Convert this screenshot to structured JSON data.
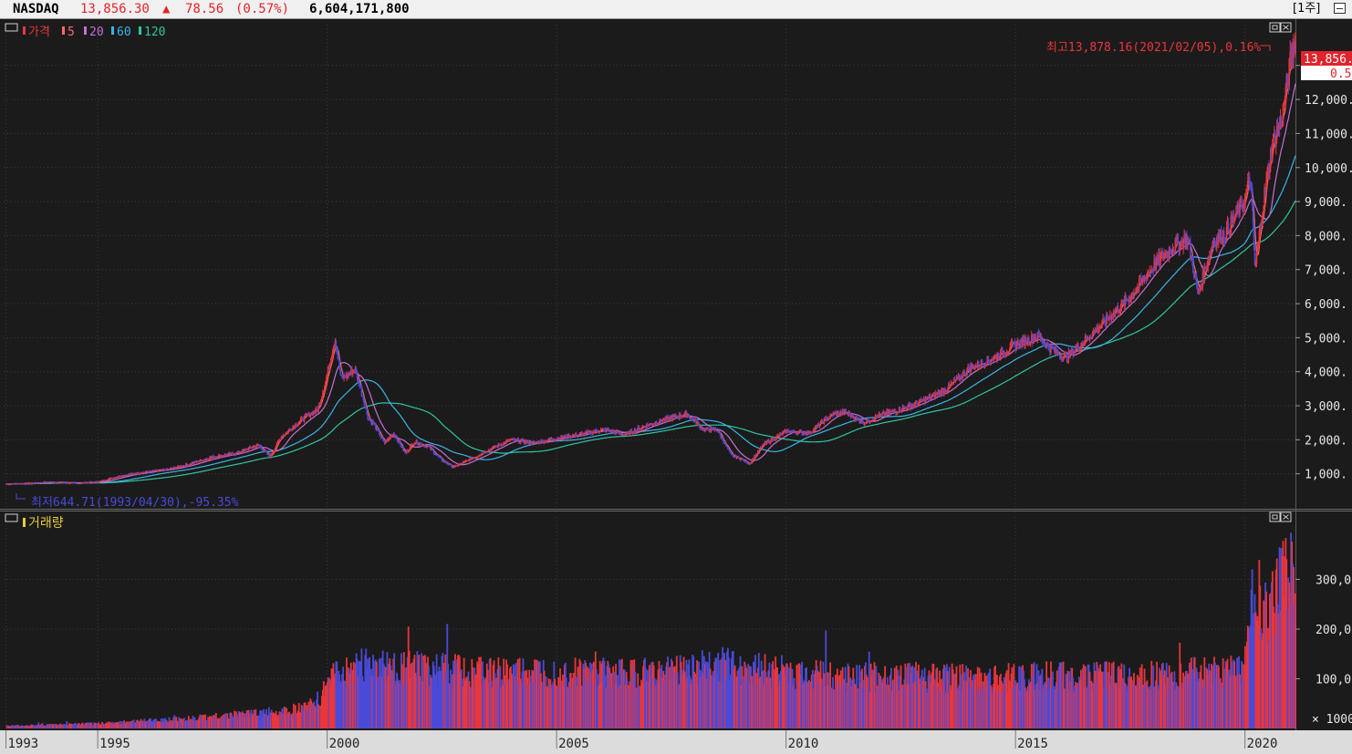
{
  "header": {
    "symbol": "NASDAQ",
    "price": "13,856.30",
    "arrow": "▲",
    "change": "78.56",
    "change_pct": "(0.57%)",
    "volume": "6,604,171,800",
    "period": "[1주]"
  },
  "colors": {
    "background": "#1b1b1b",
    "up": "#e8363b",
    "down": "#4a4ad8",
    "ma5": "#ff6a6a",
    "ma20": "#c66fd6",
    "ma60": "#3ab4e8",
    "ma120": "#2fc6a0",
    "grid": "#3c3c3c",
    "volume_label": "#e8c840",
    "high_label": "#e8363b",
    "low_label": "#4a4ad8"
  },
  "price_panel": {
    "legend": {
      "price": "가격",
      "ma5": "5",
      "ma20": "20",
      "ma60": "60",
      "ma120": "120"
    },
    "high_annotation": "최고13,878.16(2021/02/05),0.16%",
    "low_annotation": "최저644.71(1993/04/30),-95.35%",
    "last_value_tag": "13,856.",
    "last_change_tag": "0.5"
  },
  "volume_panel": {
    "legend": "거래량",
    "unit_label": "× 1000"
  },
  "chart_data": [
    {
      "type": "line",
      "title": "",
      "series_type": "weekly candlestick with moving averages",
      "x_label": "",
      "y_label": "",
      "x_ticks": [
        "1993",
        "1995",
        "2000",
        "2005",
        "2010",
        "2015",
        "2020"
      ],
      "y_ticks": [
        "1,000.",
        "2,000.",
        "3,000.",
        "4,000.",
        "5,000.",
        "6,000.",
        "7,000.",
        "8,000.",
        "9,000.",
        "10,000.",
        "11,000.",
        "12,000.",
        "13,000."
      ],
      "x_range": [
        1992.95,
        2021.1
      ],
      "ylim": [
        0,
        14200
      ],
      "grid": true,
      "last_value": 13856.3,
      "high": {
        "date": "2021/02/05",
        "value": 13878.16
      },
      "low": {
        "date": "1993/04/30",
        "value": 644.71
      },
      "price": {
        "x": [
          1993.0,
          1993.5,
          1994.0,
          1994.5,
          1995.0,
          1995.5,
          1996.0,
          1996.5,
          1997.0,
          1997.5,
          1998.0,
          1998.5,
          1998.75,
          1999.0,
          1999.5,
          1999.8,
          2000.0,
          2000.17,
          2000.3,
          2000.45,
          2000.6,
          2000.75,
          2000.9,
          2001.0,
          2001.25,
          2001.45,
          2001.7,
          2001.9,
          2002.2,
          2002.5,
          2002.75,
          2003.0,
          2003.5,
          2004.0,
          2004.5,
          2005.0,
          2005.5,
          2006.0,
          2006.5,
          2007.0,
          2007.5,
          2007.85,
          2008.2,
          2008.5,
          2008.8,
          2009.0,
          2009.2,
          2009.5,
          2010.0,
          2010.5,
          2011.0,
          2011.3,
          2011.7,
          2012.0,
          2012.5,
          2013.0,
          2013.5,
          2014.0,
          2014.5,
          2015.0,
          2015.5,
          2015.75,
          2016.1,
          2016.5,
          2017.0,
          2017.5,
          2018.0,
          2018.45,
          2018.75,
          2018.98,
          2019.3,
          2019.6,
          2020.0,
          2020.12,
          2020.22,
          2020.4,
          2020.6,
          2020.8,
          2021.0,
          2021.1
        ],
        "y": [
          700,
          720,
          760,
          720,
          760,
          950,
          1050,
          1120,
          1290,
          1500,
          1600,
          1850,
          1500,
          2100,
          2650,
          2900,
          3900,
          5000,
          3800,
          3900,
          4100,
          3400,
          2600,
          2500,
          1900,
          2200,
          1600,
          1950,
          1800,
          1400,
          1200,
          1350,
          1700,
          2000,
          1900,
          2050,
          2150,
          2300,
          2150,
          2450,
          2650,
          2750,
          2300,
          2300,
          1550,
          1450,
          1300,
          1850,
          2250,
          2200,
          2750,
          2800,
          2500,
          2700,
          2900,
          3150,
          3500,
          4100,
          4400,
          4800,
          5050,
          4700,
          4400,
          4900,
          5550,
          6200,
          7100,
          7700,
          7900,
          6300,
          7800,
          8100,
          9100,
          9700,
          7000,
          9000,
          10700,
          11400,
          13200,
          13856
        ]
      },
      "ma_notes": "MA5, MA20, MA60, MA120 smoothed lines follow the price"
    },
    {
      "type": "bar",
      "title": "",
      "y_ticks": [
        "100,0",
        "200,0",
        "300,0"
      ],
      "unit": "× 1000",
      "x_range": [
        1992.95,
        2021.1
      ],
      "volume_profile": {
        "x": [
          1993.0,
          1995.0,
          1997.0,
          1999.0,
          1999.6,
          1999.9,
          2000.0,
          2000.7,
          2002.0,
          2004.0,
          2007.0,
          2008.8,
          2009.2,
          2011.0,
          2014.0,
          2016.0,
          2018.0,
          2019.5,
          2020.0,
          2020.2,
          2020.5,
          2020.9,
          2021.1
        ],
        "y": [
          1,
          2,
          4,
          7,
          9,
          13,
          20,
          25,
          24,
          22,
          22,
          26,
          24,
          21,
          20,
          21,
          21,
          23,
          25,
          57,
          46,
          62,
          72
        ]
      }
    }
  ]
}
